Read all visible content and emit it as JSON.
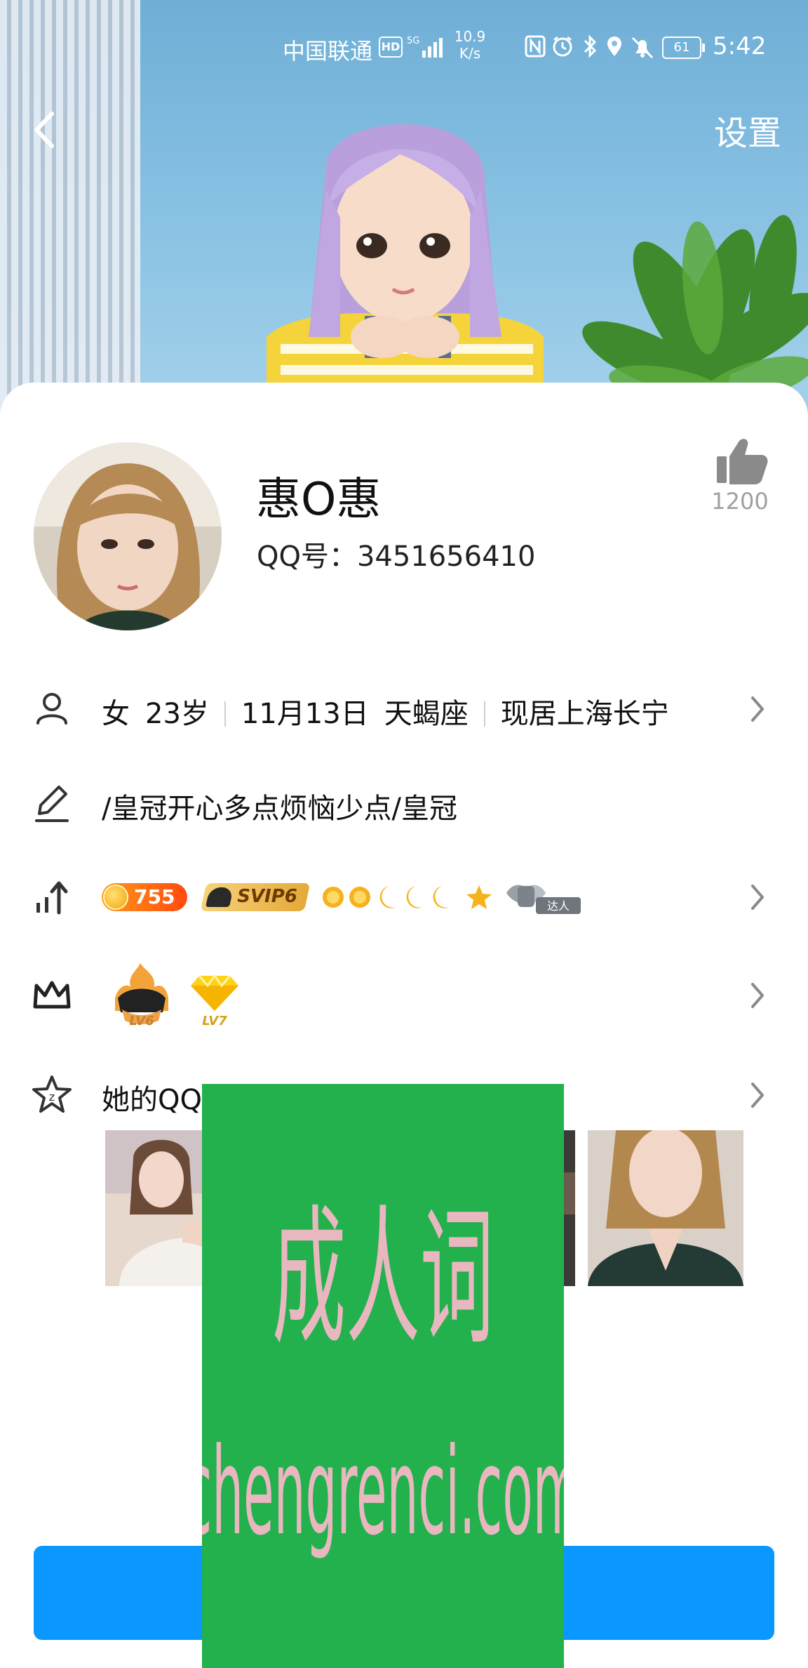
{
  "status_bar": {
    "carrier": "中国联通",
    "hd": "HD",
    "network": "5G",
    "speed_value": "10.9",
    "speed_unit": "K/s",
    "battery": "61",
    "time": "5:42"
  },
  "nav": {
    "back_icon": "chevron-left-icon",
    "settings_label": "设置"
  },
  "profile": {
    "nickname": "惠O惠",
    "qq_number": "QQ号：3451656410",
    "like_icon": "thumbs-up-icon",
    "like_count": "1200"
  },
  "info_row": {
    "gender": "女",
    "age": "23岁",
    "birthday": "11月13日",
    "zodiac": "天蝎座",
    "location": "现居上海长宁"
  },
  "signature_row": {
    "text": "/皇冠开心多点烦恼少点/皇冠"
  },
  "level_row": {
    "coin_count": "755",
    "svip_label": "SVIP6",
    "daren_label": "达人"
  },
  "crown_row": {
    "badge1_label": "LV6",
    "badge2_label": "LV7"
  },
  "space_row": {
    "title": "她的QQ空间"
  },
  "watermark": {
    "line1": "成人词",
    "line2": "chengrenci.com"
  },
  "colors": {
    "accent": "#0a98ff",
    "watermark_bg": "#22b14c",
    "watermark_text": "#e9b7bf"
  }
}
